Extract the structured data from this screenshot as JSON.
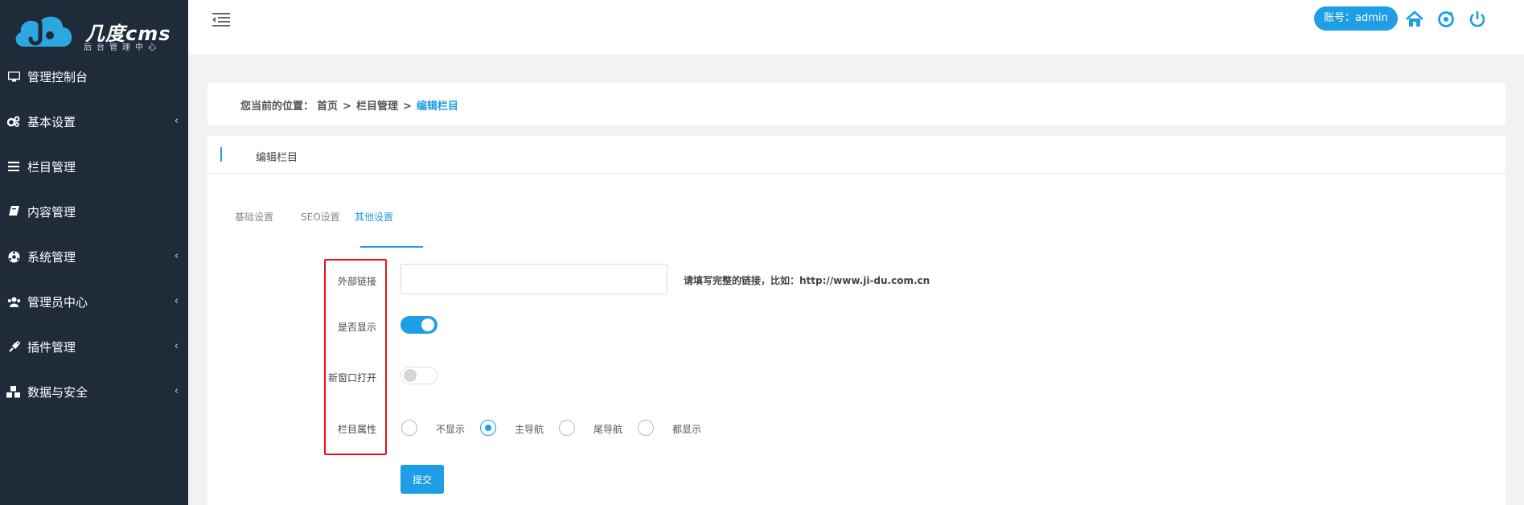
{
  "brand": {
    "name": "几度cms",
    "subtitle": "后台管理中心"
  },
  "sidebar": {
    "items": [
      {
        "label": "管理控制台",
        "icon": "monitor-icon",
        "has_submenu": false
      },
      {
        "label": "基本设置",
        "icon": "cogs-icon",
        "has_submenu": true
      },
      {
        "label": "栏目管理",
        "icon": "list-icon",
        "has_submenu": false
      },
      {
        "label": "内容管理",
        "icon": "book-icon",
        "has_submenu": false
      },
      {
        "label": "系统管理",
        "icon": "gear-icon",
        "has_submenu": true
      },
      {
        "label": "管理员中心",
        "icon": "users-icon",
        "has_submenu": true
      },
      {
        "label": "插件管理",
        "icon": "plug-icon",
        "has_submenu": true
      },
      {
        "label": "数据与安全",
        "icon": "cubes-icon",
        "has_submenu": true
      }
    ]
  },
  "header": {
    "account": "账号：admin"
  },
  "breadcrumb": {
    "prefix": "您当前的位置：",
    "items": [
      "首页",
      "栏目管理"
    ],
    "current": "编辑栏目",
    "separator": ">"
  },
  "card": {
    "title": "编辑栏目"
  },
  "tabs": [
    {
      "label": "基础设置",
      "active": false
    },
    {
      "label": "SEO设置",
      "active": false
    },
    {
      "label": "其他设置",
      "active": true
    }
  ],
  "form": {
    "external_link": {
      "label": "外部链接",
      "value": "",
      "placeholder": "",
      "hint": "请填写完整的链接，比如：http://www.ji-du.com.cn"
    },
    "is_visible": {
      "label": "是否显示",
      "on": true
    },
    "new_window": {
      "label": "新窗口打开",
      "on": false
    },
    "column_attr": {
      "label": "栏目属性",
      "options": [
        "不显示",
        "主导航",
        "尾导航",
        "都显示"
      ],
      "selected": "主导航"
    },
    "submit_label": "提交"
  },
  "colors": {
    "accent": "#1e9ee4",
    "sidebar_bg": "#202b3a",
    "highlight_box": "#e5101a"
  }
}
